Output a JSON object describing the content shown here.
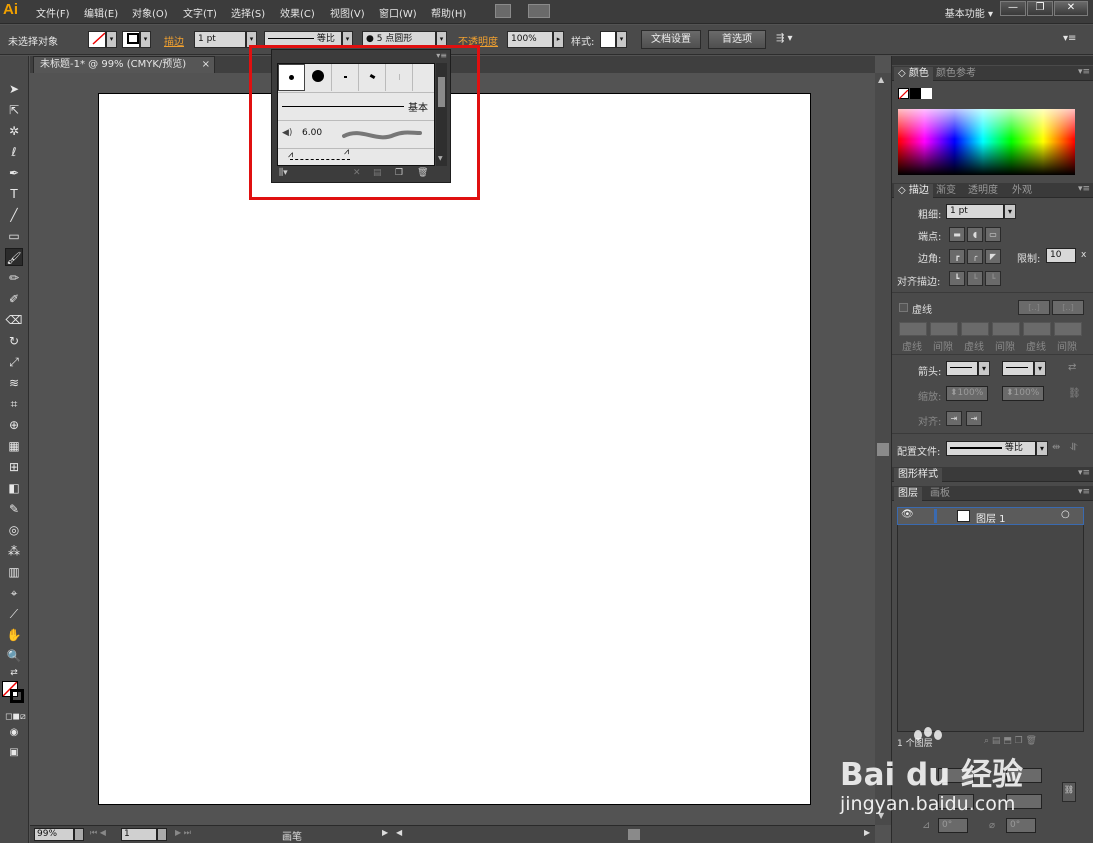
{
  "app": {
    "logo": "Ai",
    "menus": [
      "文件(F)",
      "编辑(E)",
      "对象(O)",
      "文字(T)",
      "选择(S)",
      "效果(C)",
      "视图(V)",
      "窗口(W)",
      "帮助(H)"
    ],
    "workspace": "基本功能"
  },
  "control_bar": {
    "selection_status": "未选择对象",
    "stroke_label": "描边",
    "stroke_weight": "1 pt",
    "profile": "等比",
    "brush": "5 点圆形",
    "opacity_label": "不透明度",
    "opacity_value": "100%",
    "style_label": "样式",
    "doc_setup_button": "文档设置",
    "preferences_button": "首选项"
  },
  "document": {
    "tab_title": "未标题-1* @ 99% (CMYK/预览)",
    "zoom": "99%",
    "artboard_number": "1",
    "status_text": "画笔"
  },
  "brush_popup": {
    "basic_label": "基本",
    "size_value": "6.00"
  },
  "panels": {
    "color_tabs": [
      "颜色",
      "颜色参考"
    ],
    "stroke_tabs": [
      "描边",
      "渐变",
      "透明度",
      "外观"
    ],
    "stroke": {
      "weight_label": "粗细",
      "weight_value": "1 pt",
      "cap_label": "端点",
      "corner_label": "边角",
      "limit_label": "限制",
      "limit_value": "10",
      "limit_unit": "x",
      "align_label": "对齐描边",
      "dashed_label": "虚线",
      "dash_labels": [
        "虚线",
        "间隙",
        "虚线",
        "间隙",
        "虚线",
        "间隙"
      ],
      "arrow_label": "箭头",
      "scale_label": "缩放",
      "scale_a": "100%",
      "scale_b": "100%",
      "align2_label": "对齐",
      "profile_label": "配置文件",
      "profile_value": "等比"
    },
    "graphic_styles_tab": "图形样式",
    "layer_tabs": [
      "图层",
      "画板"
    ],
    "layer_name": "图层 1",
    "layer_count": "1 个图层",
    "transform_angle_a": "0°",
    "transform_angle_b": "0°"
  },
  "watermark": {
    "brand": "Bai du 经验",
    "url": "jingyan.baidu.com"
  },
  "colors": {
    "highlight": "#e01010",
    "accent_orange": "#f0a030",
    "ui_dark": "#3c3c3c",
    "ui_mid": "#4a4a4a",
    "canvas": "#535353"
  }
}
